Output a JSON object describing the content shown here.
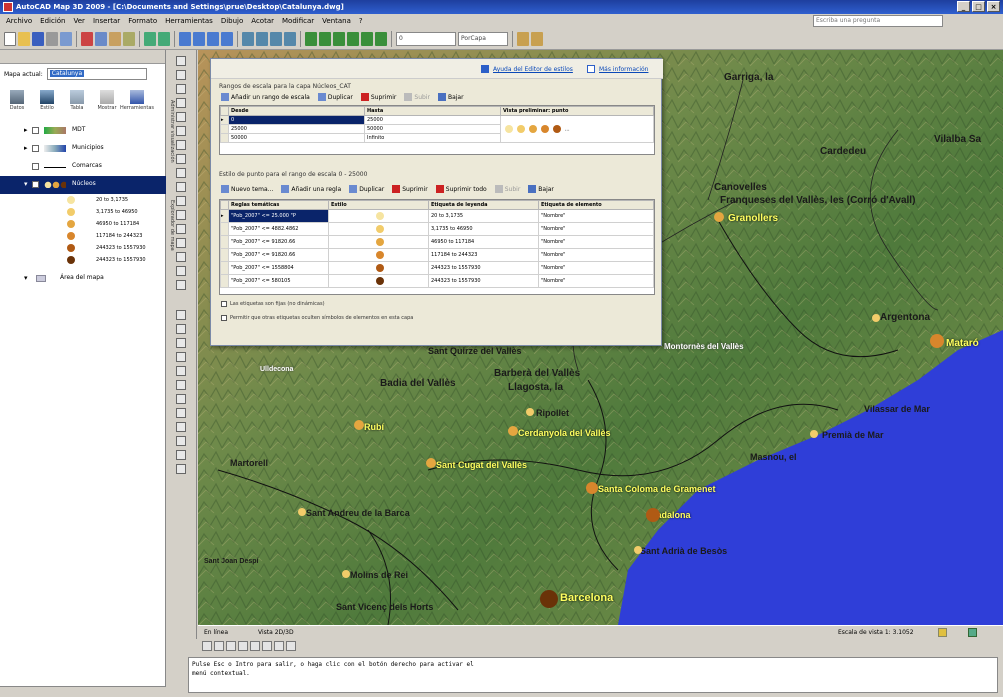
{
  "window": {
    "title": "AutoCAD Map 3D 2009 - [C:\\Documents and Settings\\prue\\Desktop\\Catalunya.dwg]",
    "controls": [
      "_",
      "□",
      "×"
    ]
  },
  "menu": {
    "items": [
      "Archivo",
      "Edición",
      "Ver",
      "Insertar",
      "Formato",
      "Herramientas",
      "Dibujo",
      "Acotar",
      "Modificar",
      "Ventana",
      "?"
    ],
    "search_placeholder": "Escriba una pregunta"
  },
  "toolbar": {
    "layer_dropdown": "0",
    "style_dropdown": "PorCapa"
  },
  "left_panel": {
    "map_label": "Mapa actual:",
    "map_value": "Catalunya",
    "buttons": [
      "Datos",
      "Estilo",
      "Tabla",
      "Mostrar",
      "Herramientas"
    ],
    "layers": [
      {
        "name": "MDT",
        "selected": false
      },
      {
        "name": "Municipios",
        "selected": false
      },
      {
        "name": "Comarcas",
        "selected": false
      },
      {
        "name": "Núcleos",
        "selected": true
      }
    ],
    "legend": [
      {
        "label": "20 to 3,1735",
        "color": "#f6e4a0"
      },
      {
        "label": "3,1735 to 46950",
        "color": "#f2cc6a"
      },
      {
        "label": "46950 to 117184",
        "color": "#e4a640"
      },
      {
        "label": "117184 to 244323",
        "color": "#d8862c"
      },
      {
        "label": "244323 to 1557930",
        "color": "#b05a14"
      },
      {
        "label": "244323 to 1557930",
        "color": "#6a3208"
      }
    ],
    "bottom_item": "Área del mapa"
  },
  "style_editor": {
    "links": [
      "Ayuda del Editor de estilos",
      "Más información"
    ],
    "scale_group": "Rangos de escala para la capa Núcleos_CAT",
    "scale_buttons": [
      "Añadir un rango de escala",
      "Duplicar",
      "Suprimir",
      "Subir",
      "Bajar"
    ],
    "scale_headers": [
      "Desde",
      "Hasta",
      "Vista preliminar: punto"
    ],
    "scale_rows": [
      {
        "from": "0",
        "to": "25000"
      },
      {
        "from": "25000",
        "to": "50000"
      },
      {
        "from": "50000",
        "to": "Infinito"
      }
    ],
    "style_group": "Estilo de punto para el rango de escala 0 - 25000",
    "style_buttons": [
      "Nuevo tema...",
      "Añadir una regla",
      "Duplicar",
      "Suprimir",
      "Suprimir todo",
      "Subir",
      "Bajar"
    ],
    "style_headers": [
      "Reglas temáticas",
      "Estilo",
      "Etiqueta de leyenda",
      "Etiqueta de elemento"
    ],
    "style_rows": [
      {
        "rule": "\"Pob_2007\" <= 25.000 \"P",
        "legend": "20 to 3,1735",
        "label": "\"Nombre\""
      },
      {
        "rule": "\"Pob_2007\" <= 4882.4862",
        "legend": "3,1735 to 46950",
        "label": "\"Nombre\""
      },
      {
        "rule": "\"Pob_2007\" <= 91820.66",
        "legend": "46950 to 117184",
        "label": "\"Nombre\""
      },
      {
        "rule": "\"Pob_2007\" <= 91820.66",
        "legend": "117184 to 244323",
        "label": "\"Nombre\""
      },
      {
        "rule": "\"Pob_2007\" <= 1558804",
        "legend": "244323 to 1557930",
        "label": "\"Nombre\""
      },
      {
        "rule": "\"Pob_2007\" <= 580105",
        "legend": "244323 to 1557930",
        "label": "\"Nombre\""
      }
    ],
    "checks": [
      "Las etiquetas son fijas (no dinámicas)",
      "Permitir que otras etiquetas oculten símbolos de elementos en esta capa"
    ]
  },
  "map": {
    "places": [
      {
        "name": "Garriga, la",
        "style": "dark"
      },
      {
        "name": "Canovelles",
        "style": "dark"
      },
      {
        "name": "Franqueses del Vallès, les (Corró d'Avall)",
        "style": "dark"
      },
      {
        "name": "Granollers",
        "style": "ylw"
      },
      {
        "name": "Cardedeu",
        "style": "dark"
      },
      {
        "name": "Vilalba Sa",
        "style": "dark"
      },
      {
        "name": "Argentona",
        "style": "dark"
      },
      {
        "name": "Mataró",
        "style": "ylw"
      },
      {
        "name": "Vilassar de Mar",
        "style": "dark"
      },
      {
        "name": "Premià de Mar",
        "style": "dark"
      },
      {
        "name": "Masnou, el",
        "style": "dark"
      },
      {
        "name": "Santa Coloma de Gramenet",
        "style": "ylw"
      },
      {
        "name": "Badalona",
        "style": "ylw"
      },
      {
        "name": "Sant Adrià de Besòs",
        "style": "dark"
      },
      {
        "name": "Barcelona",
        "style": "ylw"
      },
      {
        "name": "Sant Vicenç dels Horts",
        "style": "dark"
      },
      {
        "name": "Molins de Rei",
        "style": "dark"
      },
      {
        "name": "Sant Andreu de la Barca",
        "style": "dark"
      },
      {
        "name": "Martorell",
        "style": "dark"
      },
      {
        "name": "Rubí",
        "style": "ylw"
      },
      {
        "name": "Sant Cugat del Vallès",
        "style": "ylw"
      },
      {
        "name": "Cerdanyola del Vallès",
        "style": "ylw"
      },
      {
        "name": "Ripollet",
        "style": "dark"
      },
      {
        "name": "Badia del Vallès",
        "style": "dark"
      },
      {
        "name": "Barberà del Vallès",
        "style": "dark"
      },
      {
        "name": "Llagosta, la",
        "style": "dark"
      },
      {
        "name": "Sant Quirze del Vallès",
        "style": "dark"
      },
      {
        "name": "Montornès del Vallès",
        "style": "dark"
      },
      {
        "name": "Ulldecona",
        "style": "dark"
      },
      {
        "name": "Sant Joan Despí",
        "style": "dark"
      }
    ]
  },
  "statusbar": {
    "model": "En línea",
    "vista": "Vista 2D/3D",
    "zoom": "Escala de vista 1: 3.1052"
  },
  "command": {
    "lines": [
      "Pulse Esc o Intro para salir, o haga clic con el botón derecho para activar el",
      "menú contextual."
    ]
  }
}
